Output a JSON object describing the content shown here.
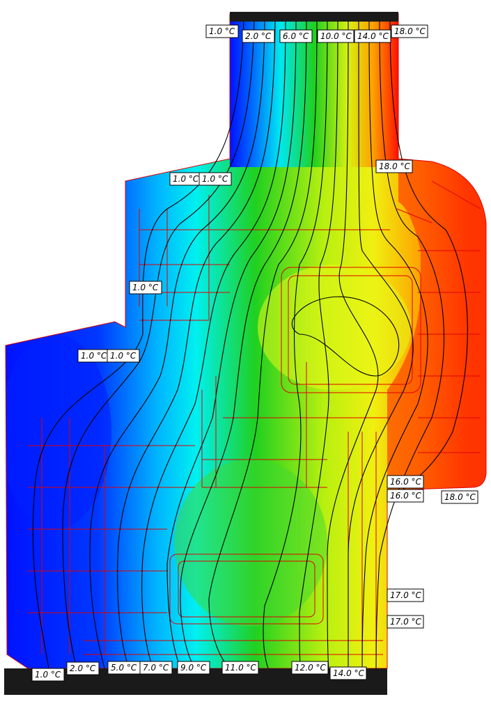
{
  "colors": {
    "cold": "#0000ff",
    "cyan": "#00f0ff",
    "green": "#20d820",
    "yellow": "#e8ff10",
    "orange": "#ffa000",
    "hot": "#ff1000",
    "frame_lines": "#e00000",
    "isotherms": "#000000",
    "blocks": "#1a1a1a"
  },
  "labels": [
    {
      "id": "t-top-1",
      "text": "1.0 °C"
    },
    {
      "id": "t-top-2",
      "text": "2.0 °C"
    },
    {
      "id": "t-top-6",
      "text": "6.0 °C"
    },
    {
      "id": "t-top-10",
      "text": "10.0 °C"
    },
    {
      "id": "t-top-14",
      "text": "14.0 °C"
    },
    {
      "id": "t-top-18",
      "text": "18.0 °C"
    },
    {
      "id": "t-right-18a",
      "text": "18.0 °C"
    },
    {
      "id": "t-left-1a",
      "text": "1.0 °C"
    },
    {
      "id": "t-left-1b",
      "text": "1.0 °C"
    },
    {
      "id": "t-left-1c",
      "text": "1.0 °C"
    },
    {
      "id": "t-left-1d",
      "text": "1.0 °C"
    },
    {
      "id": "t-left-1e",
      "text": "1.0 °C"
    },
    {
      "id": "t-right-16a",
      "text": "16.0 °C"
    },
    {
      "id": "t-right-16b",
      "text": "16.0 °C"
    },
    {
      "id": "t-right-18b",
      "text": "18.0 °C"
    },
    {
      "id": "t-right-17a",
      "text": "17.0 °C"
    },
    {
      "id": "t-right-17b",
      "text": "17.0 °C"
    },
    {
      "id": "t-bot-1",
      "text": "1.0 °C"
    },
    {
      "id": "t-bot-2",
      "text": "2.0 °C"
    },
    {
      "id": "t-bot-5",
      "text": "5.0 °C"
    },
    {
      "id": "t-bot-7",
      "text": "7.0 °C"
    },
    {
      "id": "t-bot-9",
      "text": "9.0 °C"
    },
    {
      "id": "t-bot-11",
      "text": "11.0 °C"
    },
    {
      "id": "t-bot-12",
      "text": "12.0 °C"
    },
    {
      "id": "t-bot-14",
      "text": "14.0 °C"
    }
  ]
}
